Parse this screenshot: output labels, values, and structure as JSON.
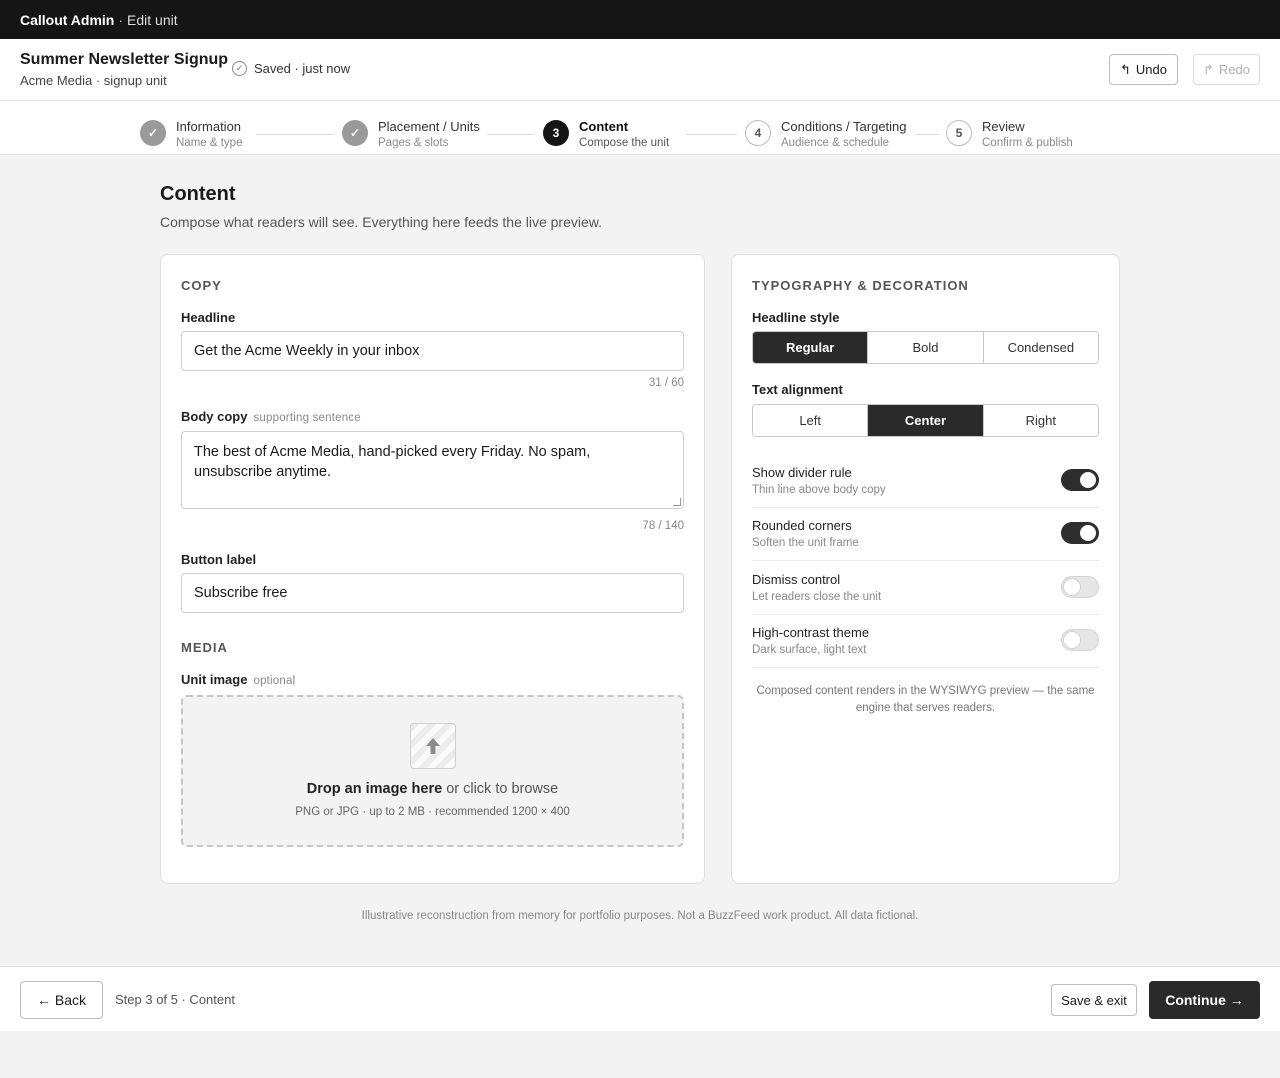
{
  "topbar": {
    "app_name": "Callout Admin",
    "separator": "·",
    "page_name": "Edit unit"
  },
  "header": {
    "title": "Summer Newsletter Signup",
    "subtitle": "Acme Media · signup unit",
    "save_status": "Saved · just now",
    "undo_label": "Undo",
    "redo_label": "Redo",
    "undo_icon": "↰",
    "redo_icon": "↱"
  },
  "stepper": {
    "steps": [
      {
        "marker": "✓",
        "label": "Information",
        "desc": "Name & type",
        "state": "done"
      },
      {
        "marker": "✓",
        "label": "Placement / Units",
        "desc": "Pages & slots",
        "state": "done"
      },
      {
        "marker": "3",
        "label": "Content",
        "desc": "Compose the unit",
        "state": "active"
      },
      {
        "marker": "4",
        "label": "Conditions / Targeting",
        "desc": "Audience & schedule",
        "state": "todo"
      },
      {
        "marker": "5",
        "label": "Review",
        "desc": "Confirm & publish",
        "state": "todo"
      }
    ]
  },
  "content": {
    "title": "Content",
    "description": "Compose what readers will see. Everything here feeds the live preview."
  },
  "copy": {
    "section_label": "COPY",
    "headline_label": "Headline",
    "headline_value": "Get the Acme Weekly in your inbox",
    "headline_counter": "31 / 60",
    "body_label": "Body copy",
    "body_hint": "supporting sentence",
    "body_value": "The best of Acme Media, hand-picked every Friday. No spam, unsubscribe anytime.",
    "body_counter": "78 / 140",
    "button_label": "Button label",
    "button_value": "Subscribe free"
  },
  "media": {
    "section_label": "MEDIA",
    "image_label": "Unit image",
    "image_hint": "optional",
    "upload_icon": "upload-arrow",
    "drop_main": "Drop an image here",
    "drop_browse": "or click to browse",
    "drop_sub": "PNG or JPG · up to 2 MB · recommended 1200 × 400"
  },
  "typography": {
    "section_label": "TYPOGRAPHY & DECORATION",
    "headline_style_label": "Headline style",
    "headline_style_options": [
      "Regular",
      "Bold",
      "Condensed"
    ],
    "headline_style_selected": "Regular",
    "alignment_label": "Text alignment",
    "alignment_options": [
      "Left",
      "Center",
      "Right"
    ],
    "alignment_selected": "Center",
    "toggles": [
      {
        "title": "Show divider rule",
        "subtitle": "Thin line above body copy",
        "on": true
      },
      {
        "title": "Rounded corners",
        "subtitle": "Soften the unit frame",
        "on": true
      },
      {
        "title": "Dismiss control",
        "subtitle": "Let readers close the unit",
        "on": false
      },
      {
        "title": "High-contrast theme",
        "subtitle": "Dark surface, light text",
        "on": false
      }
    ],
    "note": "Composed content renders in the WYSIWYG preview — the same engine that serves readers."
  },
  "disclaimer": "Illustrative reconstruction from memory for portfolio purposes. Not a BuzzFeed work product. All data fictional.",
  "footer": {
    "back_label": "← Back",
    "step_info": "Step 3 of 5 · Content",
    "save_exit_label": "Save & exit",
    "continue_label": "Continue →"
  },
  "colors": {
    "primary_dark": "#2a2a2a",
    "topbar": "#151515",
    "page_bg": "#f3f3f3"
  }
}
